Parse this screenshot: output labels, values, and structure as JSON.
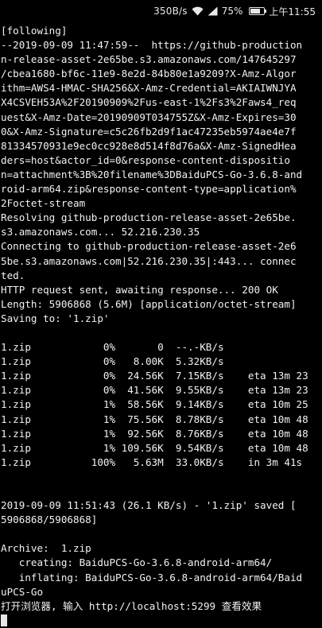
{
  "status_bar": {
    "network_speed": "350B/s",
    "battery_percent": "75%",
    "battery_level": 0.75,
    "time": "上午11:55",
    "icons": [
      "wifi-icon",
      "signal-icon",
      "battery-icon"
    ]
  },
  "terminal": {
    "lines": [
      "[following]",
      "--2019-09-09 11:47:59--  https://github-production",
      "n-release-asset-2e65be.s3.amazonaws.com/147645297",
      "/cbea1680-bf6c-11e9-8e2d-84b80e1a9209?X-Amz-Algor",
      "ithm=AWS4-HMAC-SHA256&X-Amz-Credential=AKIAIWNJYA",
      "X4CSVEH53A%2F20190909%2Fus-east-1%2Fs3%2Faws4_req",
      "uest&X-Amz-Date=20190909T034755Z&X-Amz-Expires=30",
      "0&X-Amz-Signature=c5c26fb2d9f1ac47235eb5974ae4e7f",
      "81334570931e9ec0cc928e8d514f8d76a&X-Amz-SignedHea",
      "ders=host&actor_id=0&response-content-dispositio",
      "n=attachment%3B%20filename%3DBaiduPCS-Go-3.6.8-and",
      "roid-arm64.zip&response-content-type=application%",
      "2Foctet-stream",
      "Resolving github-production-release-asset-2e65be.",
      "s3.amazonaws.com... 52.216.230.35",
      "Connecting to github-production-release-asset-2e6",
      "5be.s3.amazonaws.com|52.216.230.35|:443... connec",
      "ted.",
      "HTTP request sent, awaiting response... 200 OK",
      "Length: 5906868 (5.6M) [application/octet-stream]",
      "Saving to: '1.zip'",
      "",
      "1.zip            0%       0  --.-KB/s",
      "1.zip            0%   8.00K  5.32KB/s",
      "1.zip            0%  24.56K  7.15KB/s    eta 13m 23",
      "1.zip            0%  41.56K  9.55KB/s    eta 13m 23",
      "1.zip            1%  58.56K  9.14KB/s    eta 10m 25",
      "1.zip            1%  75.56K  8.78KB/s    eta 10m 48",
      "1.zip            1%  92.56K  8.76KB/s    eta 10m 48",
      "1.zip            1% 109.56K  9.54KB/s    eta 10m 48",
      "1.zip          100%   5.63M  33.0KB/s    in 3m 41s",
      "",
      "",
      "2019-09-09 11:51:43 (26.1 KB/s) - '1.zip' saved [",
      "5906868/5906868]",
      "",
      "Archive:  1.zip",
      "   creating: BaiduPCS-Go-3.6.8-android-arm64/",
      "   inflating: BaiduPCS-Go-3.6.8-android-arm64/Baid",
      "uPCS-Go",
      "打开浏览器, 输入 http://localhost:5299 查看效果"
    ]
  }
}
